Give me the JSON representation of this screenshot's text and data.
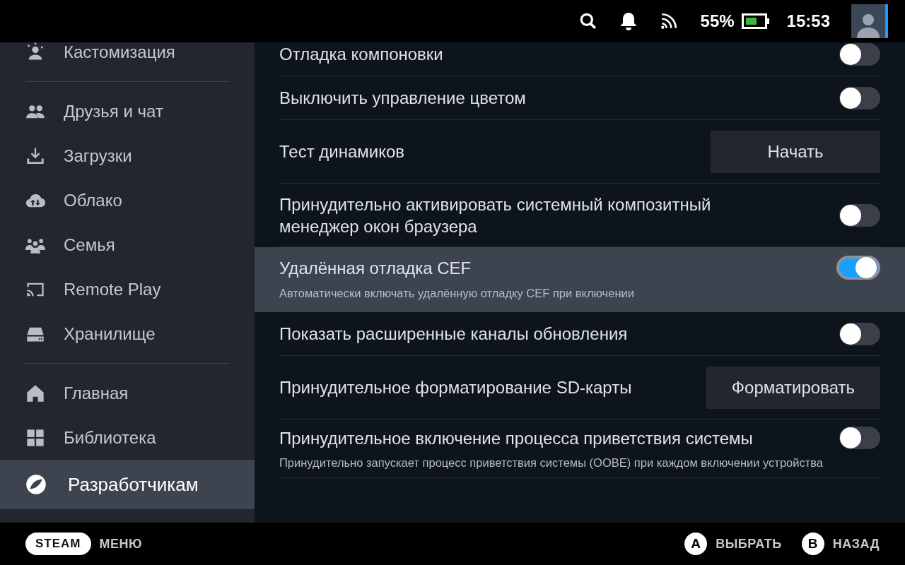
{
  "status_bar": {
    "battery": "55%",
    "time": "15:53"
  },
  "sidebar": {
    "items": [
      {
        "kind": "customize",
        "label": "Кастомизация",
        "selected": false,
        "divider_after": true
      },
      {
        "kind": "friends",
        "label": "Друзья и чат",
        "selected": false
      },
      {
        "kind": "download",
        "label": "Загрузки",
        "selected": false
      },
      {
        "kind": "cloud",
        "label": "Облако",
        "selected": false
      },
      {
        "kind": "family",
        "label": "Семья",
        "selected": false
      },
      {
        "kind": "remote",
        "label": "Remote Play",
        "selected": false
      },
      {
        "kind": "storage",
        "label": "Хранилище",
        "selected": false,
        "divider_after": true
      },
      {
        "kind": "home",
        "label": "Главная",
        "selected": false
      },
      {
        "kind": "library",
        "label": "Библиотека",
        "selected": false
      },
      {
        "kind": "developer",
        "label": "Разработчикам",
        "selected": true
      }
    ]
  },
  "settings": [
    {
      "kind": "toggle",
      "label": "Отладка компоновки",
      "on": false,
      "highlighted": false
    },
    {
      "kind": "toggle",
      "label": "Выключить управление цветом",
      "on": false,
      "highlighted": false
    },
    {
      "kind": "button",
      "label": "Тест динамиков",
      "button": "Начать",
      "highlighted": false
    },
    {
      "kind": "toggle",
      "label": "Принудительно активировать системный композитный менеджер окон браузера",
      "on": false,
      "highlighted": false
    },
    {
      "kind": "toggle",
      "label": "Удалённая отладка CEF",
      "description": "Автоматически включать удалённую отладку CEF при включении",
      "on": true,
      "highlighted": true
    },
    {
      "kind": "toggle",
      "label": "Показать расширенные каналы обновления",
      "on": false,
      "highlighted": false
    },
    {
      "kind": "button",
      "label": "Принудительное форматирование SD-карты",
      "button": "Форматировать",
      "highlighted": false
    },
    {
      "kind": "toggle",
      "label": "Принудительное включение процесса приветствия системы",
      "description": "Принудительно запускает процесс приветствия системы (OOBE) при каждом включении устройства",
      "on": false,
      "highlighted": false
    }
  ],
  "footer": {
    "steam": "STEAM",
    "menu": "МЕНЮ",
    "actions": [
      {
        "key": "A",
        "label": "ВЫБРАТЬ"
      },
      {
        "key": "B",
        "label": "НАЗАД"
      }
    ]
  }
}
